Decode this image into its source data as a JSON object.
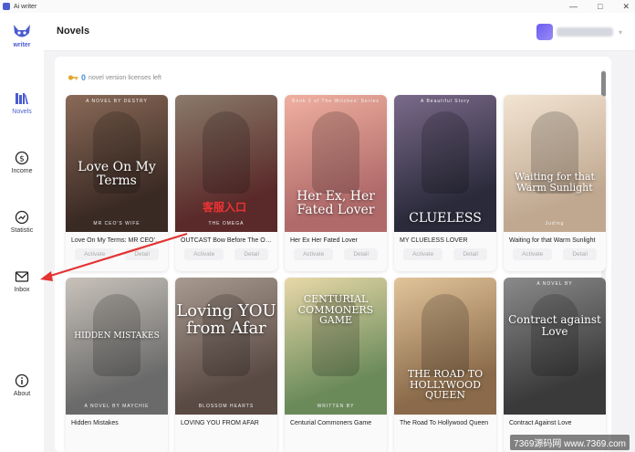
{
  "window": {
    "title": "Ai writer"
  },
  "sidebar": {
    "logo_label": "writer",
    "items": [
      {
        "label": "Novels",
        "icon": "library-icon",
        "active": true
      },
      {
        "label": "Income",
        "icon": "dollar-circle-icon",
        "active": false
      },
      {
        "label": "Statistic",
        "icon": "chart-circle-icon",
        "active": false
      },
      {
        "label": "Inbox",
        "icon": "mail-icon",
        "active": false
      },
      {
        "label": "About",
        "icon": "info-circle-icon",
        "active": false
      }
    ]
  },
  "header": {
    "title": "Novels"
  },
  "license": {
    "count": "0",
    "text": "novel version licenses left"
  },
  "actions": {
    "activate": "Activate",
    "detail": "Detail"
  },
  "overlay": {
    "stamp_text": "客服入口",
    "watermark_text": "7369源码网 www.7369.com"
  },
  "novels": [
    {
      "name": "Love On My Terms: MR CEO'S WIFE",
      "cover_text": "Love On My Terms",
      "cover_sub": "MR CEO'S WIFE",
      "top_line": "A NOVEL BY DESTRY",
      "bg": "#3a2a24",
      "bg2": "#8a6a58"
    },
    {
      "name": "OUTCAST Bow Before The Omega",
      "cover_text": "",
      "cover_sub": "THE OMEGA",
      "top_line": "",
      "bg": "#5a2a2a",
      "bg2": "#8a7a6a"
    },
    {
      "name": "Her Ex Her Fated Lover",
      "cover_text": "Her Ex, Her Fated Lover",
      "cover_sub": "",
      "top_line": "Book 2 of The Witches' Series",
      "bg": "#b06a6a",
      "bg2": "#f0b0a0"
    },
    {
      "name": "MY CLUELESS LOVER",
      "cover_text": "CLUELESS",
      "cover_sub": "",
      "top_line": "A Beautiful Story",
      "bg": "#2a2a3a",
      "bg2": "#7a6a8a"
    },
    {
      "name": "Waiting for that Warm Sunlight",
      "cover_text": "Waiting for that Warm Sunlight",
      "cover_sub": "Juding",
      "top_line": "",
      "bg": "#c0a890",
      "bg2": "#f2e4d2"
    },
    {
      "name": "Hidden Mistakes",
      "cover_text": "HIDDEN MISTAKES",
      "cover_sub": "A NOVEL BY MAYCHIE",
      "top_line": "",
      "bg": "#6a6a6a",
      "bg2": "#c8c2ba"
    },
    {
      "name": "LOVING YOU FROM AFAR",
      "cover_text": "Loving YOU from Afar",
      "cover_sub": "BLOSSOM HEARTS",
      "top_line": "",
      "bg": "#5a4a44",
      "bg2": "#a89a90"
    },
    {
      "name": "Centurial Commoners Game",
      "cover_text": "CENTURIAL COMMONERS GAME",
      "cover_sub": "WRITTEN BY",
      "top_line": "",
      "bg": "#6a8a5a",
      "bg2": "#e8d8a8"
    },
    {
      "name": "The Road To Hollywood Queen",
      "cover_text": "THE ROAD TO HOLLYWOOD QUEEN",
      "cover_sub": "",
      "top_line": "",
      "bg": "#8a6a4a",
      "bg2": "#e2c49a"
    },
    {
      "name": "Contract Against Love",
      "cover_text": "Contract against Love",
      "cover_sub": "",
      "top_line": "A NOVEL BY",
      "bg": "#3a3a3a",
      "bg2": "#8a8a8a"
    }
  ],
  "colors": {
    "accent": "#4a5bd1",
    "license_count": "#4a90e2",
    "annotation": "#e33333"
  }
}
